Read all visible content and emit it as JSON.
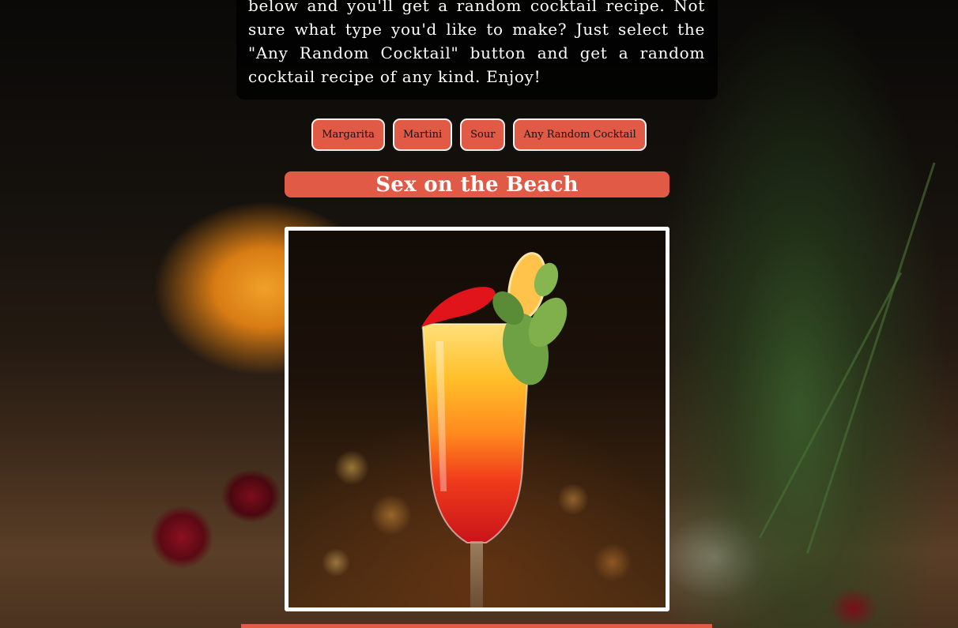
{
  "intro": {
    "text": "below and you'll get a random cocktail recipe. Not sure what type you'd like to make? Just select the \"Any Random Cocktail\" button and get a random cocktail recipe of any kind. Enjoy!"
  },
  "buttons": [
    {
      "label": "Margarita"
    },
    {
      "label": "Martini"
    },
    {
      "label": "Sour"
    },
    {
      "label": "Any Random Cocktail"
    }
  ],
  "cocktail": {
    "name": "Sex on the Beach",
    "image": "cocktail-photo"
  },
  "colors": {
    "accent": "#e05a45",
    "intro_background": "rgba(0,0,0,0.75)",
    "text_light": "#ffffff",
    "button_text": "#111111"
  }
}
